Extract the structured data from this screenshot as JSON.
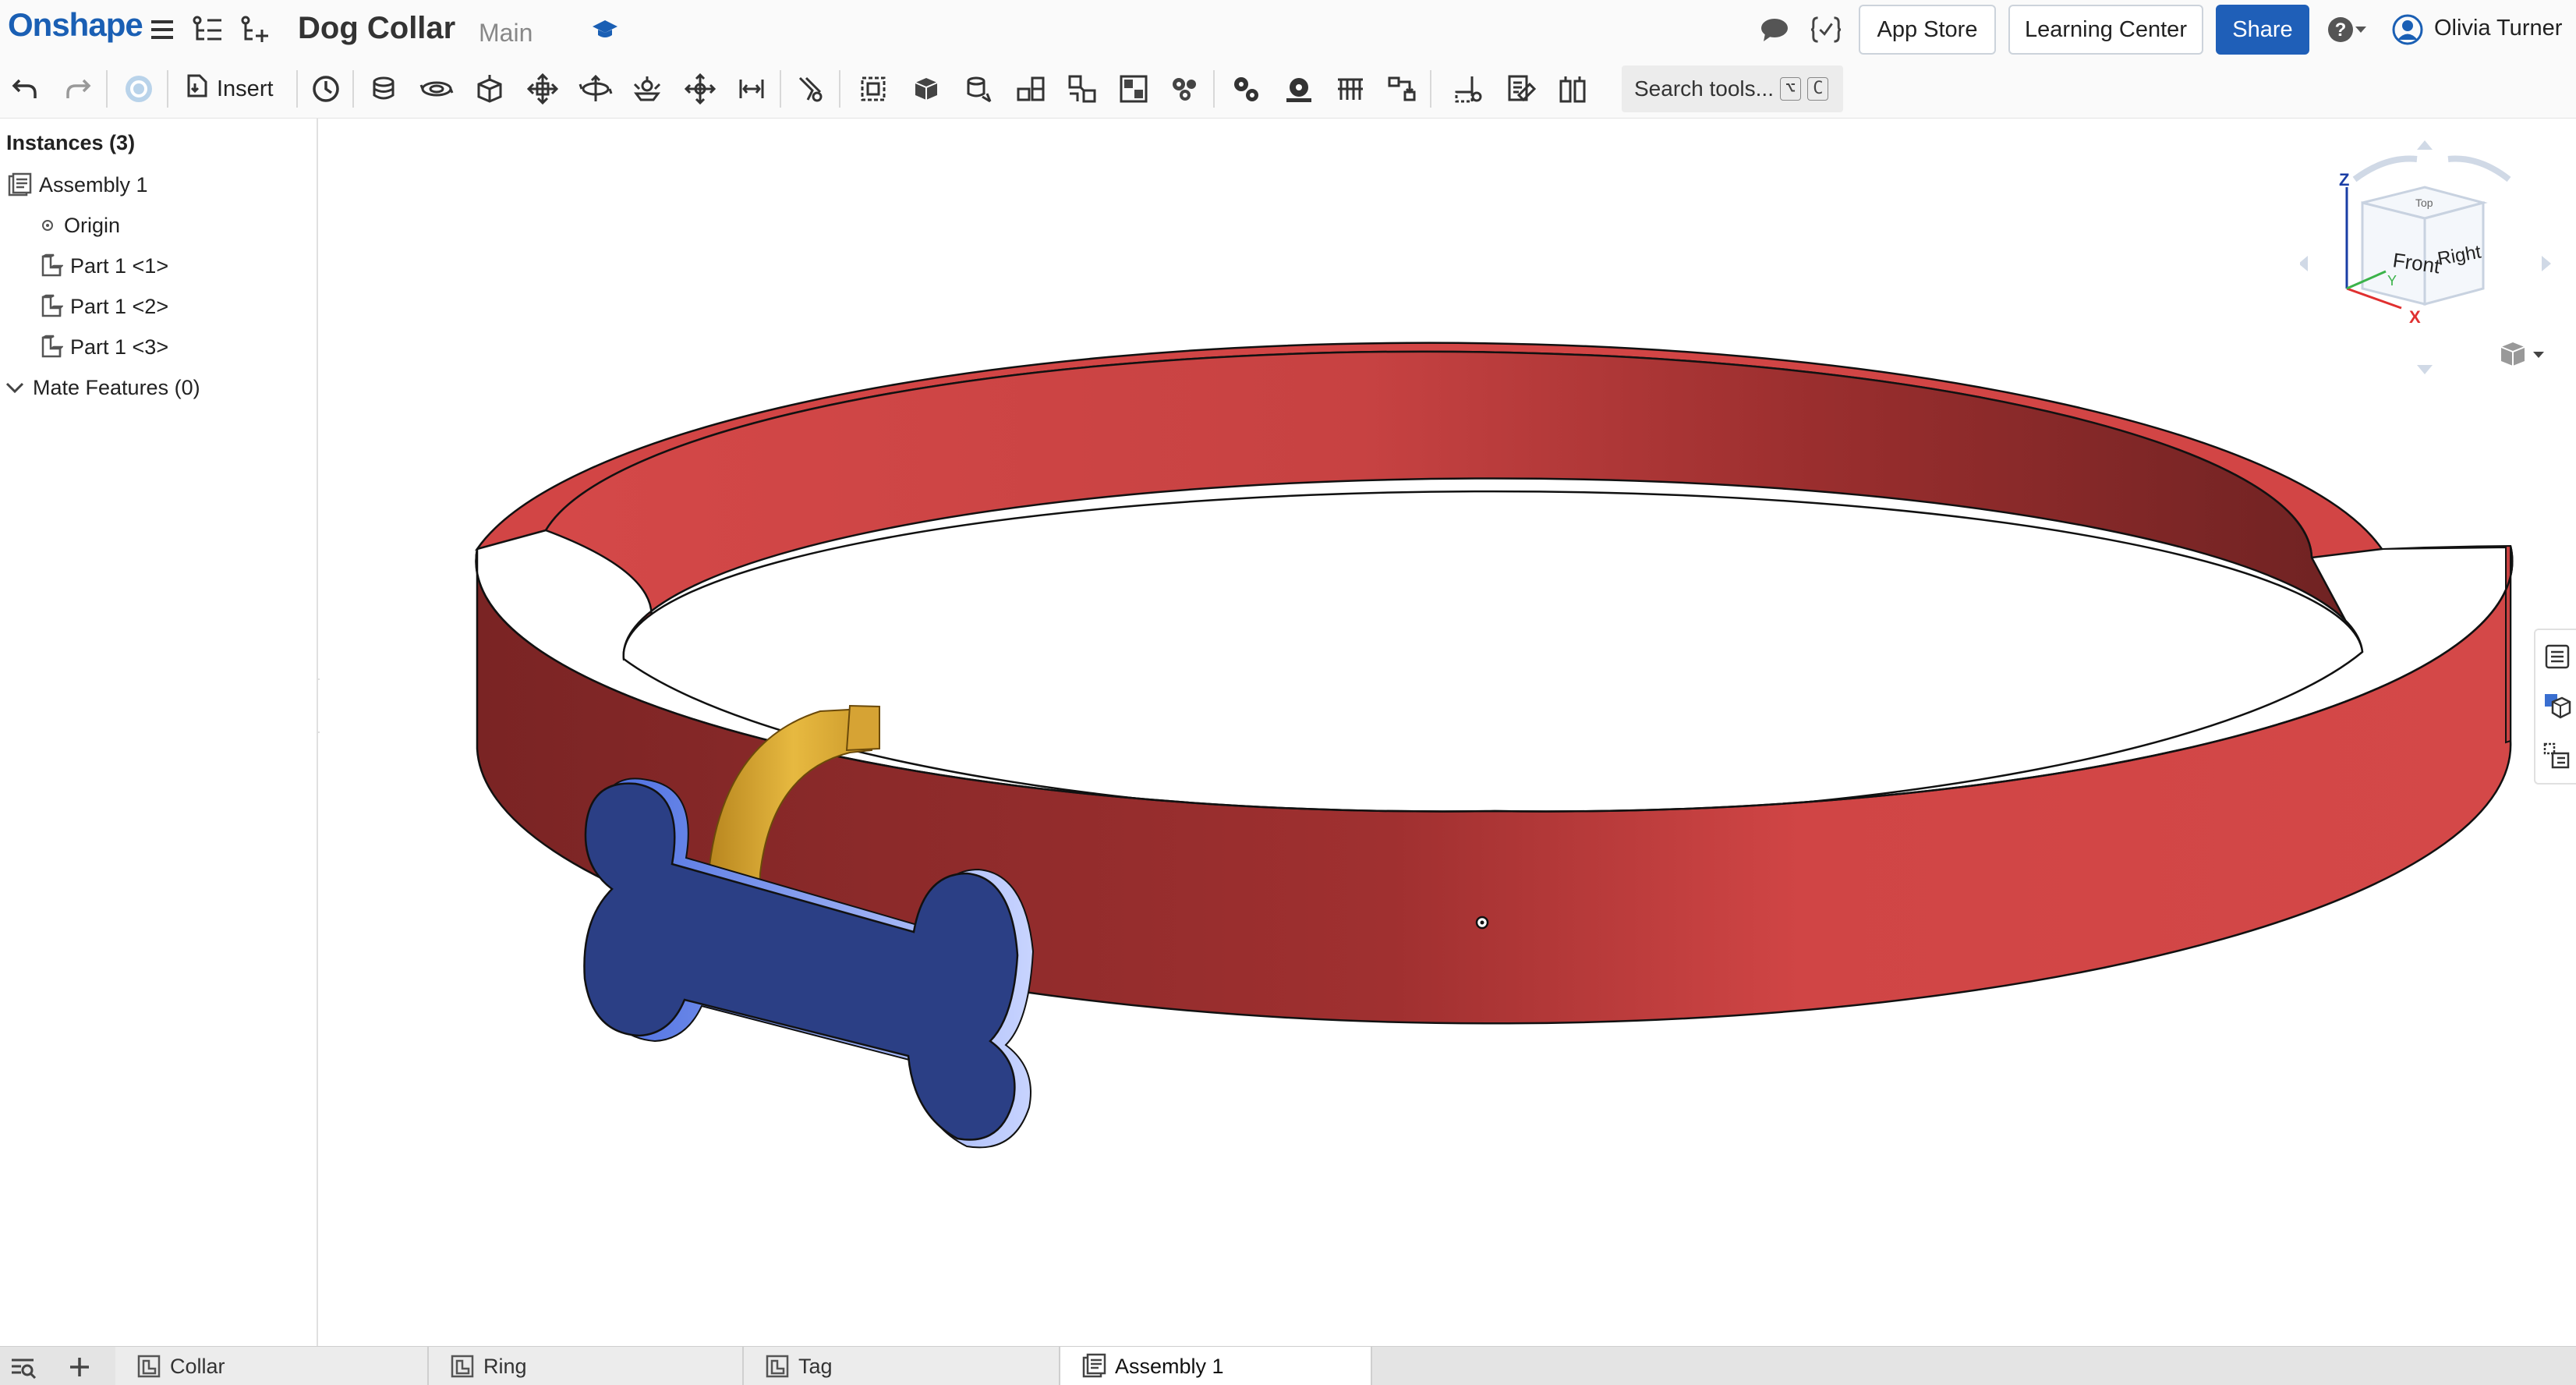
{
  "app": {
    "logo": "Onshape",
    "document_title": "Dog Collar",
    "branch": "Main"
  },
  "topbar": {
    "app_store": "App Store",
    "learning_center": "Learning Center",
    "share": "Share",
    "user_name": "Olivia Turner",
    "icons": [
      "menu-icon",
      "feature-tree-icon",
      "add-feature-icon",
      "education-cap-icon",
      "comment-icon",
      "variables-icon",
      "help-icon",
      "chevron-down-icon",
      "user-avatar-icon"
    ]
  },
  "toolbar": {
    "insert_label": "Insert",
    "search_placeholder": "Search tools...",
    "search_shortcut_1": "⌥",
    "search_shortcut_2": "C",
    "tools": [
      "undo",
      "redo",
      "reload",
      "insert",
      "history",
      "fasten",
      "revolute",
      "slider",
      "planar",
      "cylindrical",
      "pin-slot",
      "ball",
      "parallel",
      "tangent",
      "mate-connector",
      "group",
      "replicate",
      "pattern",
      "explode",
      "display-states",
      "gear-relation",
      "rack-pinion",
      "screw-relation",
      "linear-relation",
      "measure",
      "section-view",
      "named-views"
    ]
  },
  "instances_panel": {
    "header": "Instances (3)",
    "items": [
      {
        "label": "Assembly 1",
        "icon": "assembly-icon"
      },
      {
        "label": "Origin",
        "icon": "origin-icon"
      },
      {
        "label": "Part 1 <1>",
        "icon": "part-icon"
      },
      {
        "label": "Part 1 <2>",
        "icon": "part-icon"
      },
      {
        "label": "Part 1 <3>",
        "icon": "part-icon"
      },
      {
        "label": "Mate Features (0)",
        "icon": "chevron-down-icon"
      }
    ]
  },
  "viewcube": {
    "front": "Front",
    "right": "Right",
    "top": "Top",
    "axis_z": "Z",
    "axis_x": "X",
    "axis_y": "Y"
  },
  "bottom_tabs": [
    {
      "label": "Collar",
      "icon": "part-studio-icon",
      "active": false
    },
    {
      "label": "Ring",
      "icon": "part-studio-icon",
      "active": false
    },
    {
      "label": "Tag",
      "icon": "part-studio-icon",
      "active": false
    },
    {
      "label": "Assembly 1",
      "icon": "assembly-icon",
      "active": true
    }
  ],
  "colors": {
    "brand_blue": "#1a5fb4",
    "collar_red": "#d14444",
    "collar_dark": "#7a2424",
    "ring_gold": "#e2b33a",
    "tag_blue": "#2b4a9a"
  }
}
